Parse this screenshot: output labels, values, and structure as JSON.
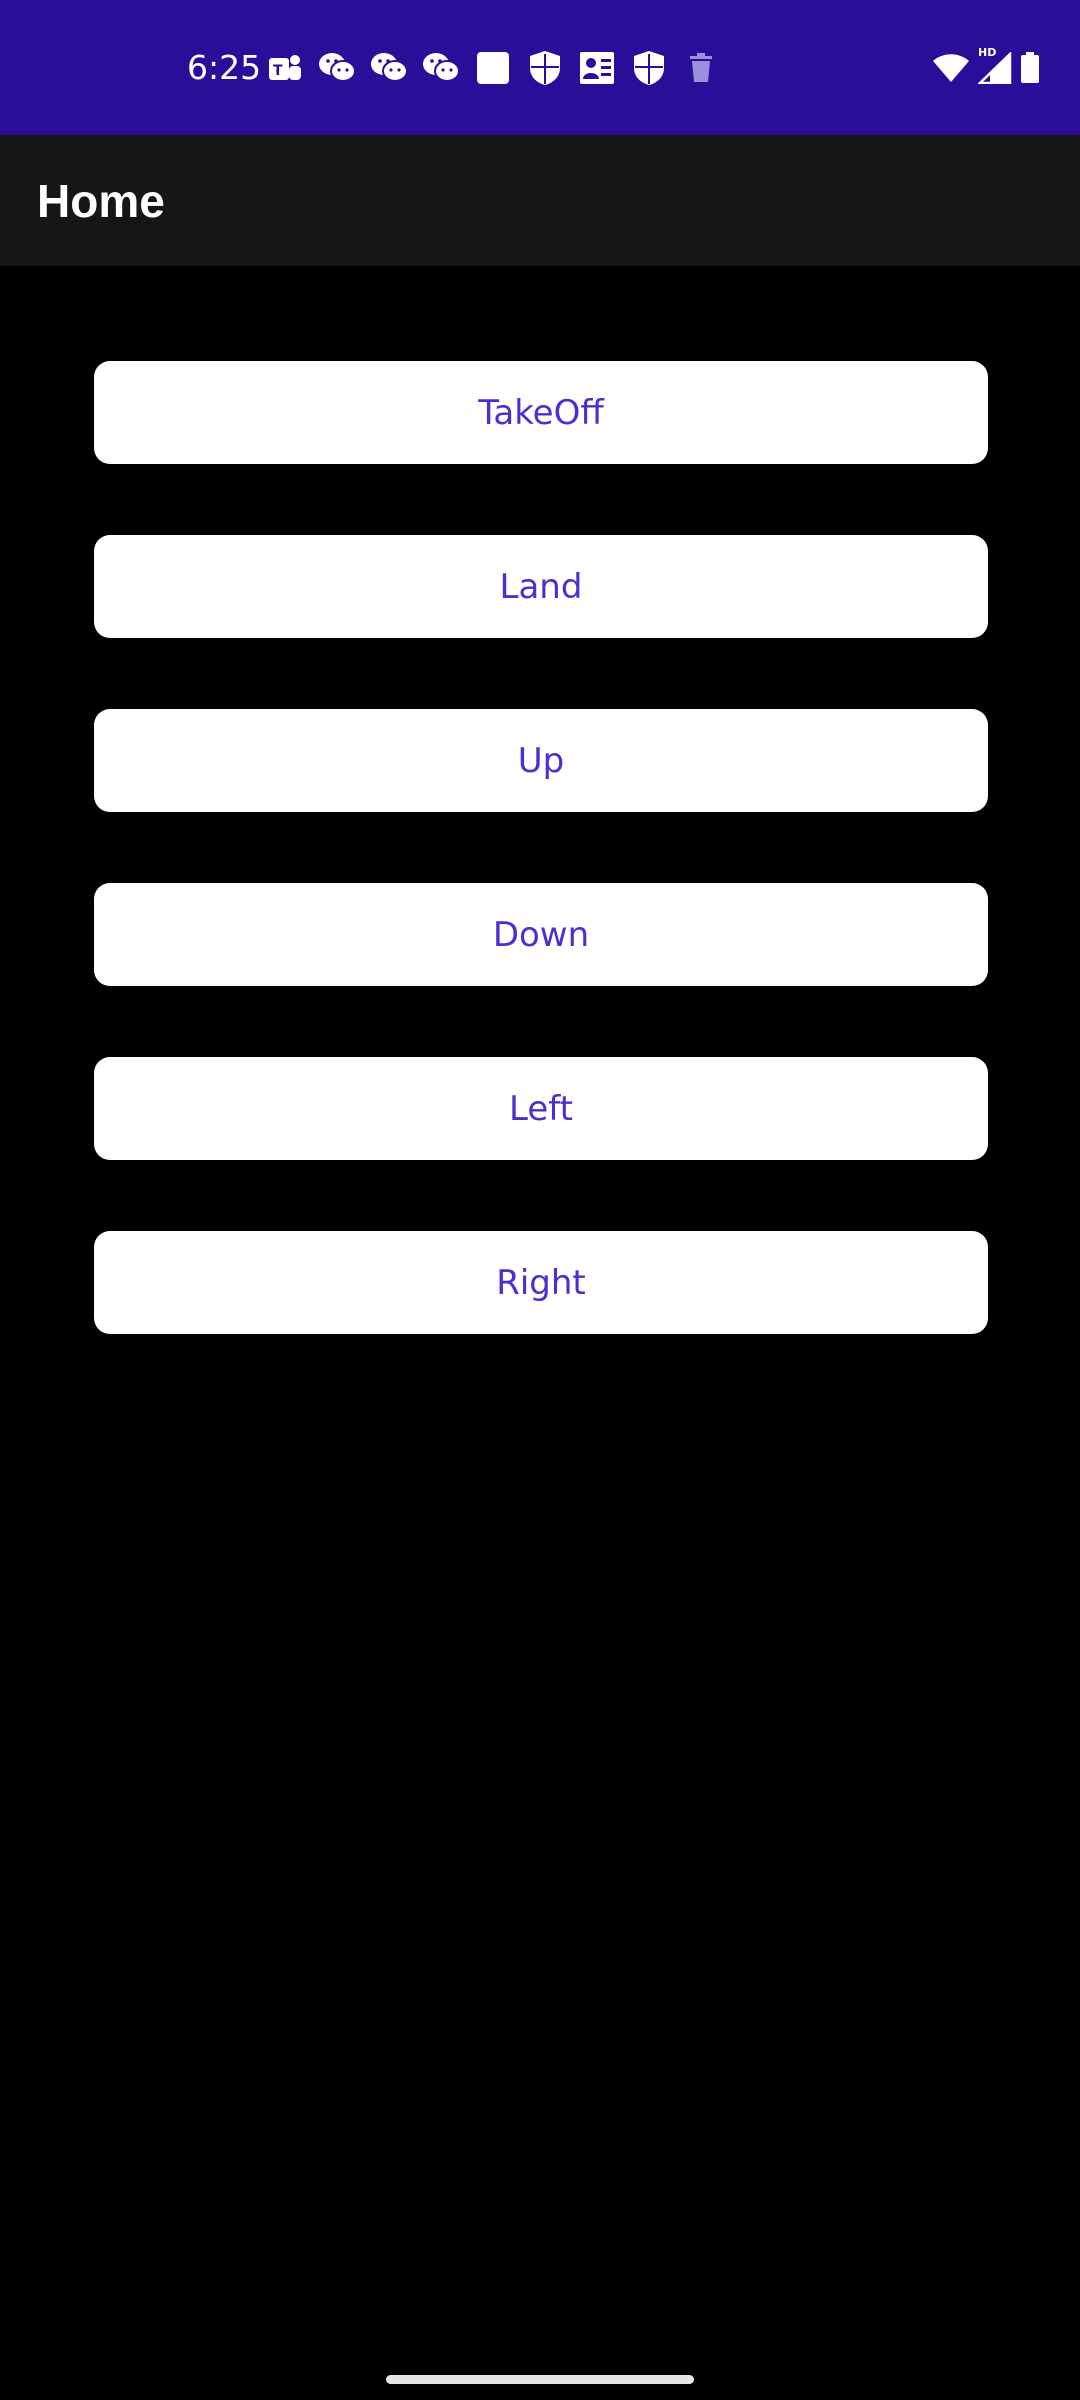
{
  "status_bar": {
    "time": "6:25",
    "background_color": "#2a0e9a",
    "notification_icons": [
      "teams-icon",
      "wechat-icon",
      "wechat-icon",
      "wechat-icon",
      "square-icon",
      "shield-icon",
      "contacts-icon",
      "shield-icon",
      "trash-icon"
    ],
    "signal_label": "HD"
  },
  "app_bar": {
    "title": "Home",
    "background_color": "#161616"
  },
  "buttons": {
    "takeoff": "TakeOff",
    "land": "Land",
    "up": "Up",
    "down": "Down",
    "left": "Left",
    "right": "Right",
    "text_color": "#4b2fd0",
    "background_color": "#ffffff"
  }
}
